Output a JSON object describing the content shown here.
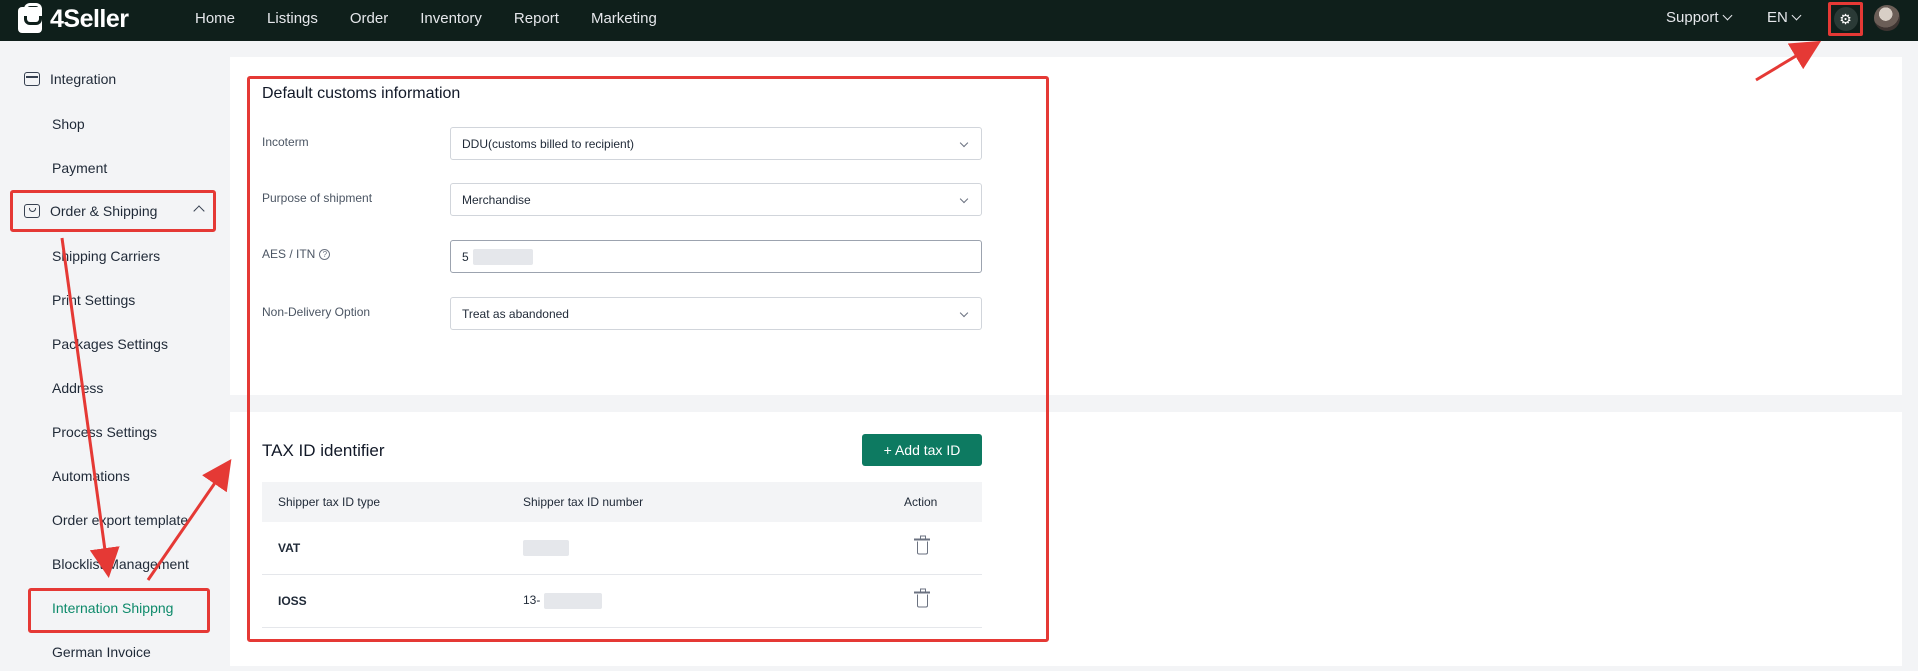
{
  "app": {
    "logo_text": "4Seller"
  },
  "topnav": {
    "items": [
      "Home",
      "Listings",
      "Order",
      "Inventory",
      "Report",
      "Marketing"
    ],
    "support": "Support",
    "language": "EN"
  },
  "sidebar": {
    "integration": "Integration",
    "shop": "Shop",
    "payment": "Payment",
    "order_shipping": "Order & Shipping",
    "items": [
      "Shipping Carriers",
      "Print Settings",
      "Packages Settings",
      "Address",
      "Process Settings",
      "Automations",
      "Order export template",
      "Blocklist Management",
      "Internation Shippng",
      "German Invoice"
    ]
  },
  "customs": {
    "title": "Default customs information",
    "incoterm_label": "Incoterm",
    "incoterm_value": "DDU(customs billed to recipient)",
    "purpose_label": "Purpose of shipment",
    "purpose_value": "Merchandise",
    "aes_label": "AES / ITN",
    "aes_value": "5",
    "nondelivery_label": "Non-Delivery Option",
    "nondelivery_value": "Treat as abandoned"
  },
  "tax": {
    "title": "TAX ID identifier",
    "add_button": "+ Add tax ID",
    "columns": [
      "Shipper tax ID type",
      "Shipper tax ID number",
      "Action"
    ],
    "rows": [
      {
        "type": "VAT",
        "number": ""
      },
      {
        "type": "IOSS",
        "number": "13-"
      }
    ]
  },
  "colors": {
    "accent": "#0d7a61",
    "highlight": "#e53935",
    "topbar": "#0f1f1b"
  },
  "icons": [
    "integration-icon",
    "bag-icon",
    "chevron-up-icon",
    "gear-icon",
    "trash-icon",
    "help-icon"
  ]
}
